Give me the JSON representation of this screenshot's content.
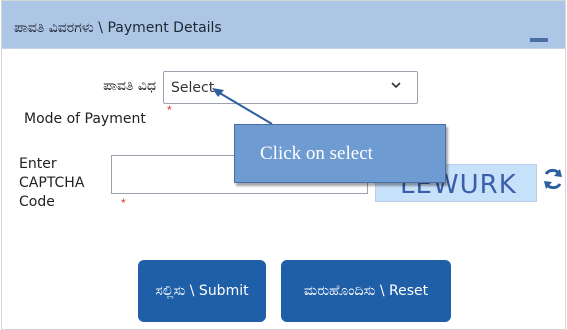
{
  "panel": {
    "title": "ಪಾವತಿ ವಿವರಗಳು \\ Payment Details"
  },
  "form": {
    "mode_label_kn": "ಪಾವತಿ ವಿಧ",
    "mode_label_en": "Mode of Payment",
    "mode_selected": "Select",
    "required_mark": "*",
    "captcha_label_line1": "Enter",
    "captcha_label_line2": "CAPTCHA",
    "captcha_label_line3": "Code",
    "captcha_input_value": "",
    "captcha_text": "LEWURK"
  },
  "buttons": {
    "submit_label": "ಸಲ್ಲಿಸು \\ Submit",
    "reset_label": "ಮರುಹೊಂದಿಸು \\ Reset"
  },
  "callout": {
    "text": "Click on select"
  },
  "icons": {
    "dropdown": "chevron-down-icon",
    "refresh": "refresh-icon",
    "minimize": "minimize-icon"
  },
  "colors": {
    "header_bg": "#aec6e6",
    "button_bg": "#1f5fa8",
    "callout_bg": "#6f9bd3",
    "required": "#d9342b",
    "captcha_bg": "#c8e1fb"
  }
}
